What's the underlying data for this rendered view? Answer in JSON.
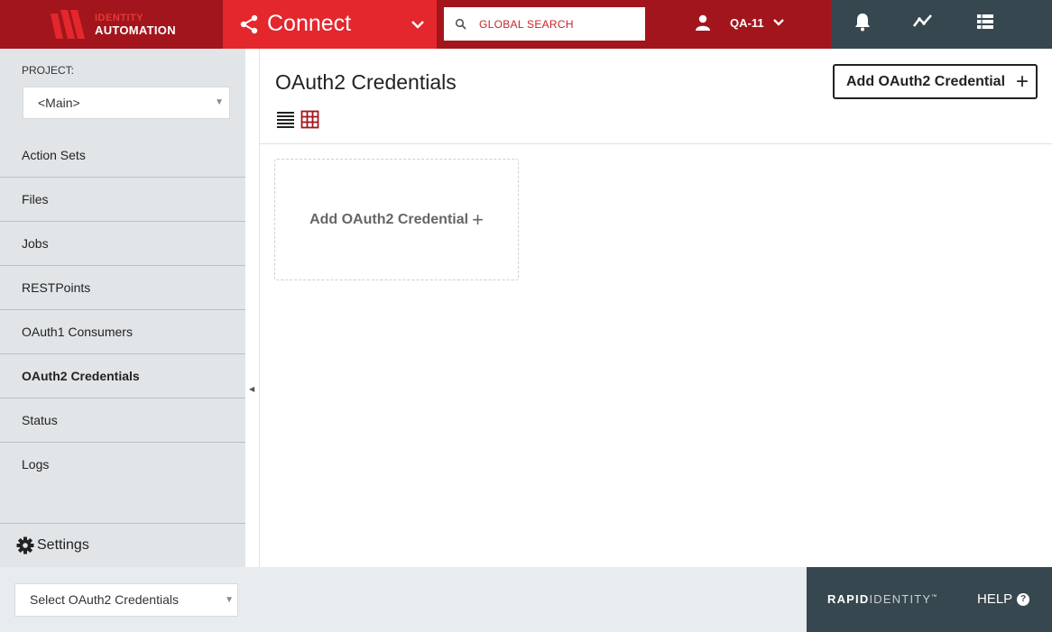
{
  "brand": {
    "line1": "IDENTITY",
    "line2": "AUTOMATION",
    "colors": {
      "dark_red": "#a3151c",
      "red": "#e4272d",
      "slate": "#37474f"
    }
  },
  "header": {
    "app_name": "Connect",
    "search_placeholder": "GLOBAL SEARCH",
    "user_name": "QA-11",
    "icons": [
      "bell-icon",
      "activity-icon",
      "apps-icon"
    ]
  },
  "sidebar": {
    "project_label": "PROJECT:",
    "project_value": "<Main>",
    "items": [
      {
        "label": "Action Sets"
      },
      {
        "label": "Files"
      },
      {
        "label": "Jobs"
      },
      {
        "label": "RESTPoints"
      },
      {
        "label": "OAuth1 Consumers"
      },
      {
        "label": "OAuth2 Credentials",
        "active": true
      },
      {
        "label": "Status"
      },
      {
        "label": "Logs"
      }
    ],
    "settings_label": "Settings"
  },
  "main": {
    "title": "OAuth2 Credentials",
    "add_button_label": "Add OAuth2 Credential",
    "add_card_label": "Add OAuth2 Credential",
    "plus_glyph": "+"
  },
  "footer": {
    "select_value": "Select OAuth2 Credentials",
    "brand_bold": "RAPID",
    "brand_thin": "IDENTITY",
    "brand_tm": "™",
    "help_label": "HELP",
    "help_glyph": "?"
  }
}
